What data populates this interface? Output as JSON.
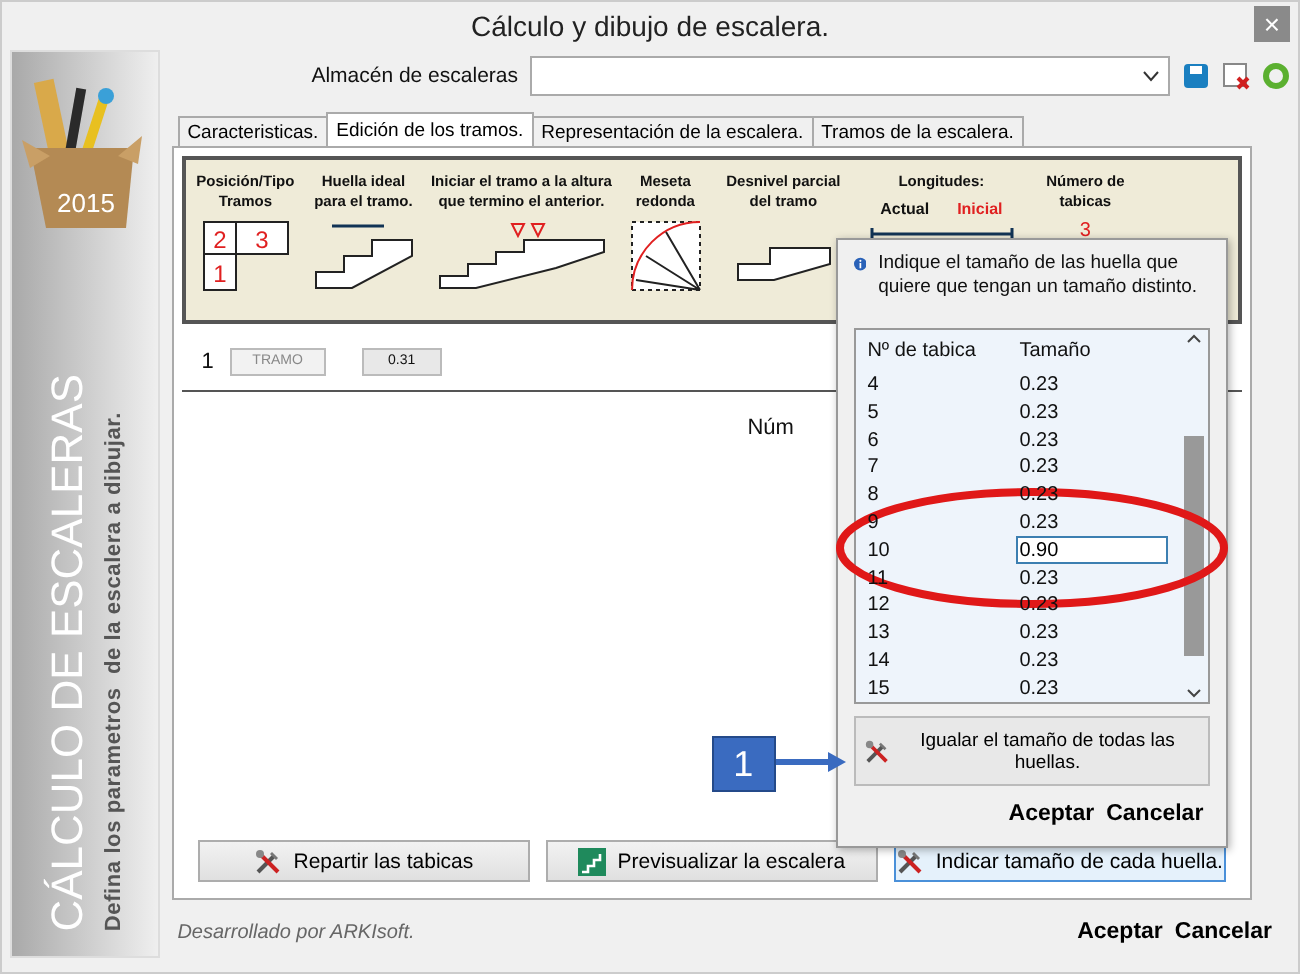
{
  "window": {
    "title": "Cálculo y dibujo de escalera.",
    "close": "×"
  },
  "sidebar": {
    "badge": "2015",
    "title": "CÁLCULO DE ESCALERAS",
    "subtitle": "Defina los parametros  de la escalera a dibujar."
  },
  "store": {
    "label": "Almacén de escaleras"
  },
  "tabs": [
    {
      "label": "Caracteristicas.",
      "selected": false
    },
    {
      "label": "Edición de los tramos.",
      "selected": true
    },
    {
      "label": "Representación de la escalera.",
      "selected": false
    },
    {
      "label": "Tramos de la escalera.",
      "selected": false
    }
  ],
  "header": [
    {
      "kind": "position",
      "label": "Posición/Tipo Tramos",
      "digits": [
        "2",
        "3",
        "1"
      ]
    },
    {
      "kind": "tread",
      "label": "Huella ideal para el tramo."
    },
    {
      "kind": "start",
      "label": "Iniciar el tramo a la altura que termino el anterior."
    },
    {
      "kind": "landing",
      "label": "Meseta redonda"
    },
    {
      "kind": "level",
      "label": "Desnivel parcial del tramo"
    },
    {
      "kind": "lengths",
      "label": "Longitudes:",
      "actual": "Actual",
      "initial": "Inicial"
    },
    {
      "kind": "count",
      "label": "Número de tabicas",
      "value": "3"
    }
  ],
  "flights": [
    {
      "number": "1",
      "type": "TRAMO",
      "tread": "0.31"
    }
  ],
  "count_label": "Núm",
  "buttons": [
    {
      "kind": "tools",
      "label": "Repartir las tabicas",
      "selected": false
    },
    {
      "kind": "preview",
      "label": "Previsualizar la escalera",
      "selected": false
    },
    {
      "kind": "tools",
      "label": "Indicar tamaño de cada huella.",
      "selected": true
    }
  ],
  "popup": {
    "info": "Indique el tamaño de las huella que quiere que tengan un tamaño distinto.",
    "columns": [
      "Nº de tabica",
      "Tamaño"
    ],
    "rows": [
      {
        "n": "4",
        "size": "0.23",
        "selected": false
      },
      {
        "n": "5",
        "size": "0.23",
        "selected": false
      },
      {
        "n": "6",
        "size": "0.23",
        "selected": false
      },
      {
        "n": "7",
        "size": "0.23",
        "selected": false
      },
      {
        "n": "8",
        "size": "0.23",
        "selected": false
      },
      {
        "n": "9",
        "size": "0.23",
        "selected": false
      },
      {
        "n": "10",
        "size": "0.90",
        "selected": true
      },
      {
        "n": "11",
        "size": "0.23",
        "selected": false
      },
      {
        "n": "12",
        "size": "0.23",
        "selected": false
      },
      {
        "n": "13",
        "size": "0.23",
        "selected": false
      },
      {
        "n": "14",
        "size": "0.23",
        "selected": false
      },
      {
        "n": "15",
        "size": "0.23",
        "selected": false
      }
    ],
    "equalize": "Igualar el tamaño de todas las huellas.",
    "accept": "Aceptar",
    "cancel": "Cancelar"
  },
  "callout": "1",
  "footer": {
    "credit": "Desarrollado por ARKIsoft.",
    "accept": "Aceptar",
    "cancel": "Cancelar"
  }
}
